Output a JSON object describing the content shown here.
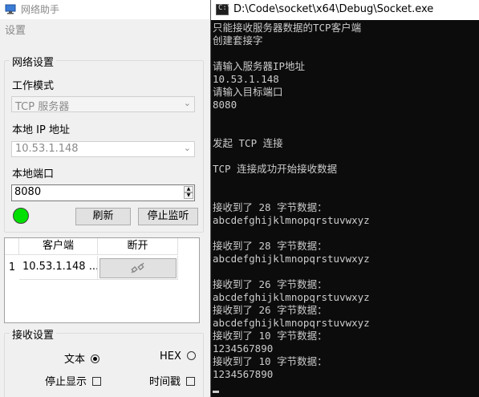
{
  "left_app": {
    "title": "网络助手",
    "menu": {
      "settings": "设置"
    },
    "network_settings": {
      "group_title": "网络设置",
      "work_mode_label": "工作模式",
      "work_mode_value": "TCP 服务器",
      "local_ip_label": "本地 IP 地址",
      "local_ip_value": "10.53.1.148",
      "local_port_label": "本地端口",
      "local_port_value": "8080",
      "refresh_label": "刷新",
      "stop_listen_label": "停止监听",
      "status_color": "#00e000"
    },
    "client_table": {
      "headers": [
        "客户端",
        "断开"
      ],
      "rows": [
        {
          "index": "1",
          "client": "10.53.1.148 ..."
        }
      ]
    },
    "receive_settings": {
      "group_title": "接收设置",
      "text_label": "文本",
      "hex_label": "HEX",
      "pause_label": "停止显示",
      "timestamp_label": "时间戳"
    }
  },
  "console": {
    "title": "D:\\Code\\socket\\x64\\Debug\\Socket.exe",
    "lines": [
      "只能接收服务器数据的TCP客户端",
      "创建套接字",
      "",
      "请输入服务器IP地址",
      "10.53.1.148",
      "请输入目标端口",
      "8080",
      "",
      "",
      "发起 TCP 连接",
      "",
      "TCP 连接成功开始接收数据",
      "",
      "",
      "接收到了 28 字节数据：",
      "abcdefghijklmnopqrstuvwxyz",
      "",
      "接收到了 28 字节数据：",
      "abcdefghijklmnopqrstuvwxyz",
      "",
      "接收到了 26 字节数据：",
      "abcdefghijklmnopqrstuvwxyz",
      "接收到了 26 字节数据：",
      "abcdefghijklmnopqrstuvwxyz",
      "接收到了 10 字节数据：",
      "1234567890",
      "接收到了 10 字节数据：",
      "1234567890"
    ]
  }
}
